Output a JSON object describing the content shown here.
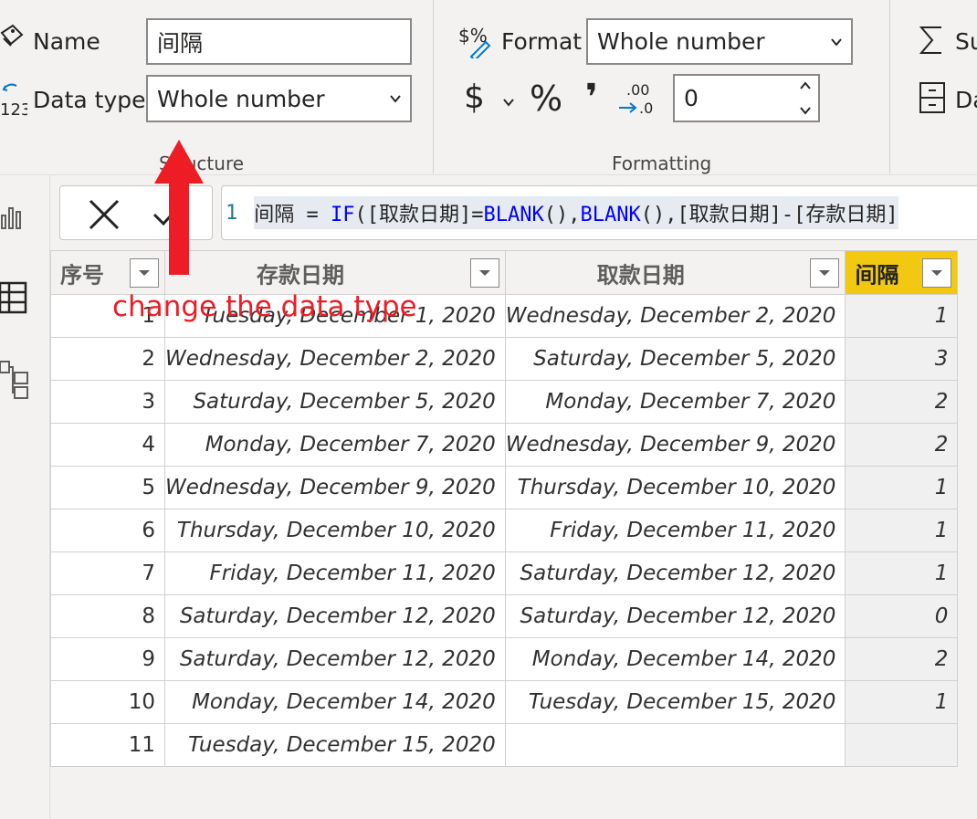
{
  "ribbon": {
    "name_label": "Name",
    "name_value": "间隔",
    "datatype_label": "Data type",
    "datatype_value": "Whole number",
    "structure_group": "Structure",
    "format_label": "Format",
    "format_value": "Whole number",
    "currency_symbol": "$",
    "percent_symbol": "%",
    "comma_symbol": "❜",
    "decimals_value": "0",
    "formatting_group": "Formatting",
    "summarization_label": "Su",
    "data_category_label": "Da",
    "icons": {
      "name": "tag-icon",
      "datatype": "datatype-icon",
      "format": "format-icon",
      "sigma": "sigma-icon",
      "category": "data-category-icon"
    }
  },
  "formula_bar": {
    "line_number": "1",
    "segments": [
      {
        "text": "间隔 = ",
        "kind": "plain"
      },
      {
        "text": "IF",
        "kind": "keyword"
      },
      {
        "text": "([取款日期]=",
        "kind": "plain"
      },
      {
        "text": "BLANK",
        "kind": "keyword"
      },
      {
        "text": "(),",
        "kind": "plain"
      },
      {
        "text": "BLANK",
        "kind": "keyword"
      },
      {
        "text": "(),[取款日期]-[存款日期]",
        "kind": "plain"
      }
    ]
  },
  "table": {
    "columns": [
      "序号",
      "存款日期",
      "取款日期",
      "间隔"
    ],
    "rows": [
      [
        "1",
        "Tuesday, December 1, 2020",
        "Wednesday, December 2, 2020",
        "1"
      ],
      [
        "2",
        "Wednesday, December 2, 2020",
        "Saturday, December 5, 2020",
        "3"
      ],
      [
        "3",
        "Saturday, December 5, 2020",
        "Monday, December 7, 2020",
        "2"
      ],
      [
        "4",
        "Monday, December 7, 2020",
        "Wednesday, December 9, 2020",
        "2"
      ],
      [
        "5",
        "Wednesday, December 9, 2020",
        "Thursday, December 10, 2020",
        "1"
      ],
      [
        "6",
        "Thursday, December 10, 2020",
        "Friday, December 11, 2020",
        "1"
      ],
      [
        "7",
        "Friday, December 11, 2020",
        "Saturday, December 12, 2020",
        "1"
      ],
      [
        "8",
        "Saturday, December 12, 2020",
        "Saturday, December 12, 2020",
        "0"
      ],
      [
        "9",
        "Saturday, December 12, 2020",
        "Monday, December 14, 2020",
        "2"
      ],
      [
        "10",
        "Monday, December 14, 2020",
        "Tuesday, December 15, 2020",
        "1"
      ],
      [
        "11",
        "Tuesday, December 15, 2020",
        "",
        ""
      ]
    ]
  },
  "annotation": {
    "text": "change the data type",
    "color": "#ee1c25"
  },
  "colors": {
    "highlight_column": "#f2c811",
    "keyword": "#0000ff"
  }
}
